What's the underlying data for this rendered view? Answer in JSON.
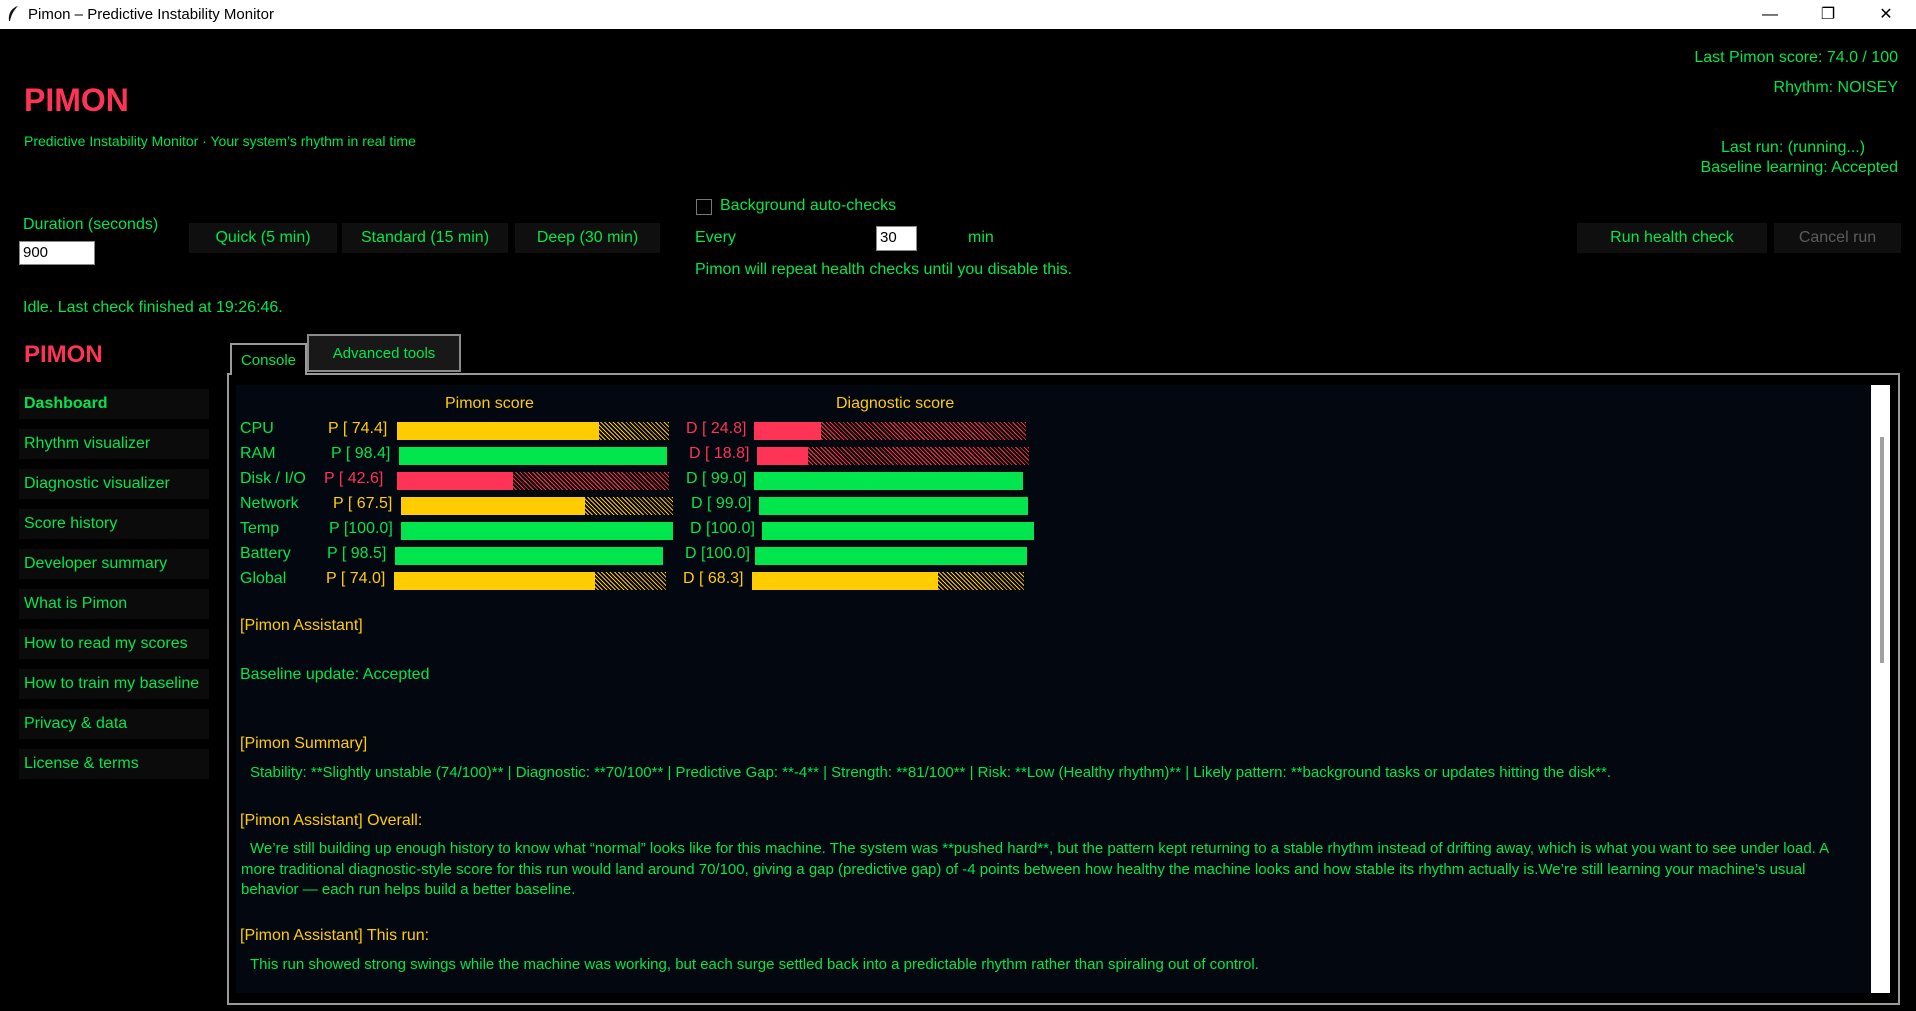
{
  "window": {
    "title": "Pimon – Predictive Instability Monitor",
    "minimize": "—",
    "restore": "❐",
    "close": "✕"
  },
  "header": {
    "logo": "PIMON",
    "subtitle": "Predictive Instability Monitor · Your system’s rhythm in real time",
    "last_score": "Last Pimon score: 74.0 / 100",
    "rhythm": "Rhythm: NOISEY",
    "last_run": "Last run: (running...)",
    "baseline": "Baseline learning: Accepted"
  },
  "controls": {
    "duration_label": "Duration (seconds)",
    "duration_value": "900",
    "quick": "Quick (5 min)",
    "standard": "Standard (15 min)",
    "deep": "Deep (30 min)",
    "auto_label": "Background auto-checks",
    "auto_checked": false,
    "every_label": "Every",
    "every_value": "30",
    "min_label": "min",
    "auto_note": "Pimon will repeat health checks until you disable this.",
    "run": "Run health check",
    "cancel": "Cancel run",
    "status": "Idle. Last check finished at 19:26:46."
  },
  "sidebar": {
    "logo": "PIMON",
    "items": [
      {
        "label": "Dashboard",
        "active": true
      },
      {
        "label": "Rhythm visualizer"
      },
      {
        "label": "Diagnostic visualizer"
      },
      {
        "label": "Score history"
      },
      {
        "label": "Developer summary"
      },
      {
        "label": "What is Pimon"
      },
      {
        "label": "How to read my scores"
      },
      {
        "label": "How to train my baseline"
      },
      {
        "label": "Privacy & data"
      },
      {
        "label": "License & terms"
      }
    ]
  },
  "tabs": {
    "console": "Console",
    "advanced": "Advanced tools"
  },
  "colors": {
    "green": "#00e64c",
    "yellow": "#ffcc00",
    "red": "#ff3355"
  },
  "scores": {
    "pimon_header": "Pimon score",
    "diag_header": "Diagnostic score",
    "rows": [
      {
        "name": "CPU",
        "p_label": "P [ 74.4]",
        "p": 74.4,
        "p_color": "yellow",
        "d_label": "D [ 24.8]",
        "d": 24.8,
        "d_color": "red"
      },
      {
        "name": "RAM",
        "p_label": "P [ 98.4]",
        "p": 98.4,
        "p_color": "green",
        "d_label": "D [ 18.8]",
        "d": 18.8,
        "d_color": "red"
      },
      {
        "name": "Disk / I/O",
        "p_label": "P [ 42.6]",
        "p": 42.6,
        "p_color": "red",
        "d_label": "D [ 99.0]",
        "d": 99.0,
        "d_color": "green"
      },
      {
        "name": "Network",
        "p_label": "P [ 67.5]",
        "p": 67.5,
        "p_color": "yellow",
        "d_label": "D [ 99.0]",
        "d": 99.0,
        "d_color": "green"
      },
      {
        "name": "Temp",
        "p_label": "P [100.0]",
        "p": 100.0,
        "p_color": "green",
        "d_label": "D [100.0]",
        "d": 100.0,
        "d_color": "green"
      },
      {
        "name": "Battery",
        "p_label": "P [ 98.5]",
        "p": 98.5,
        "p_color": "green",
        "d_label": "D [100.0]",
        "d": 100.0,
        "d_color": "green"
      },
      {
        "name": "Global",
        "p_label": "P [ 74.0]",
        "p": 74.0,
        "p_color": "yellow",
        "d_label": "D [ 68.3]",
        "d": 68.3,
        "d_color": "yellow"
      }
    ]
  },
  "console": {
    "assistant_header": "[Pimon Assistant]",
    "baseline_update": "Baseline update: Accepted",
    "summary_header": "[Pimon Summary]",
    "summary_text": "Stability: **Slightly unstable (74/100)** | Diagnostic: **70/100** | Predictive Gap: **-4** | Strength: **81/100** | Risk: **Low (Healthy rhythm)** | Likely pattern: **background tasks or updates hitting the disk**.",
    "overall_header": "[Pimon Assistant] Overall:",
    "overall_text": "We’re still building up enough history to know what “normal” looks like for this machine. The system was **pushed hard**, but the pattern kept returning to a stable rhythm instead of drifting away, which is what you want to see under load.  A more traditional diagnostic-style score for this run would land around 70/100, giving a gap (predictive gap) of -4 points between how healthy the machine looks and how stable its rhythm actually is.We’re still learning your machine’s usual behavior — each run helps build a better baseline.",
    "thisrun_header": "[Pimon Assistant] This run:",
    "thisrun_text": "This run showed strong swings while the machine was working, but each surge settled back into a predictable rhythm rather than spiraling out of control."
  }
}
